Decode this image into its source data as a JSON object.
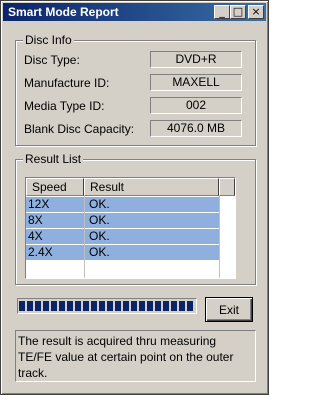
{
  "window": {
    "title": "Smart Mode Report",
    "controls": {
      "minimize": "_",
      "maximize": "□",
      "close": "×"
    }
  },
  "disc_info": {
    "legend": "Disc Info",
    "fields": [
      {
        "label": "Disc Type:",
        "value": "DVD+R"
      },
      {
        "label": "Manufacture ID:",
        "value": "MAXELL"
      },
      {
        "label": "Media Type ID:",
        "value": "002"
      },
      {
        "label": "Blank Disc Capacity:",
        "value": "4076.0 MB"
      }
    ]
  },
  "result_list": {
    "legend": "Result List",
    "columns": [
      "Speed",
      "Result"
    ],
    "rows": [
      {
        "speed": "12X",
        "result": "OK."
      },
      {
        "speed": "8X",
        "result": "OK."
      },
      {
        "speed": "4X",
        "result": "OK."
      },
      {
        "speed": "2.4X",
        "result": "OK."
      }
    ],
    "selected_color": "#8fb0de"
  },
  "progress": {
    "value_percent": 100,
    "color": "#0a246a"
  },
  "buttons": {
    "exit": "Exit"
  },
  "message": "The result is acquired thru measuring TE/FE value at certain point on the outer track."
}
